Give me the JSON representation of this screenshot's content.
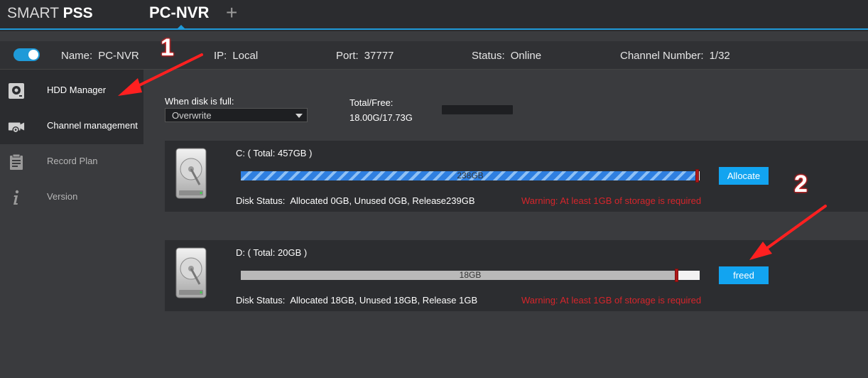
{
  "app": {
    "brand_prefix": "SMART",
    "brand_suffix": "PSS",
    "active_tab": "PC-NVR",
    "add_tab": "+"
  },
  "device": {
    "enabled": true,
    "name_label": "Name:",
    "name_value": "PC-NVR",
    "ip_label": "IP:",
    "ip_value": "Local",
    "port_label": "Port:",
    "port_value": "37777",
    "status_label": "Status:",
    "status_value": "Online",
    "channel_label": "Channel Number:",
    "channel_value": "1/32"
  },
  "sidebar": {
    "items": [
      {
        "label": "HDD Manager",
        "icon": "hdd-icon",
        "state": "active"
      },
      {
        "label": "Channel management",
        "icon": "camera-gear-icon",
        "state": "normal"
      },
      {
        "label": "Record Plan",
        "icon": "clipboard-icon",
        "state": "dim"
      },
      {
        "label": "Version",
        "icon": "info-icon",
        "state": "dim"
      }
    ]
  },
  "settings": {
    "when_full_label": "When disk is full:",
    "when_full_value": "Overwrite",
    "total_free_label": "Total/Free:",
    "total_free_value": "18.00G/17.73G"
  },
  "disks": [
    {
      "title": "C: ( Total: 457GB )",
      "bar_text": "238GB",
      "fill_fraction": 0.995,
      "fill_style": "striped",
      "action_label": "Allocate",
      "status_label": "Disk Status:",
      "status_value": "Allocated 0GB, Unused 0GB, Release239GB",
      "warning": "Warning: At least 1GB of storage is required"
    },
    {
      "title": "D: ( Total: 20GB )",
      "bar_text": "18GB",
      "fill_fraction": 0.95,
      "fill_style": "gray",
      "action_label": "freed",
      "status_label": "Disk Status:",
      "status_value": "Allocated 18GB, Unused 18GB, Release 1GB",
      "warning": "Warning: At least 1GB of storage is required"
    }
  ],
  "annotations": {
    "step1": "1",
    "step2": "2"
  },
  "colors": {
    "accent": "#1f9ad8",
    "button": "#12a4f0",
    "warning": "#d6252b",
    "arrow": "#ff2020"
  }
}
